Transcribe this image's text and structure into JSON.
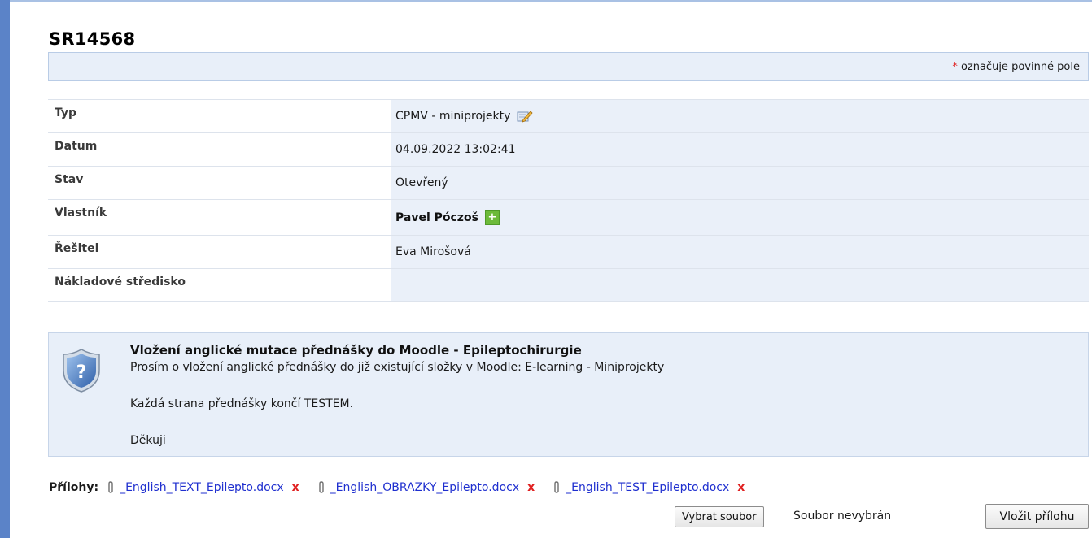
{
  "ticket": {
    "id": "SR14568"
  },
  "required_note": {
    "star": "*",
    "text": "označuje povinné pole"
  },
  "fields": [
    {
      "label": "Typ",
      "value": "CPMV - miniprojekty"
    },
    {
      "label": "Datum",
      "value": "04.09.2022 13:02:41"
    },
    {
      "label": "Stav",
      "value": "Otevřený"
    },
    {
      "label": "Vlastník",
      "value": "Pavel Póczoš"
    },
    {
      "label": "Řešitel",
      "value": "Eva Mirošová"
    },
    {
      "label": "Nákladové středisko",
      "value": ""
    }
  ],
  "description": {
    "title": "Vložení anglické mutace přednášky do Moodle - Epileptochirurgie",
    "lines": [
      "Prosím o vložení anglické přednášky do již existující složky v Moodle: E-learning - Miniprojekty",
      "Každá strana přednášky končí TESTEM.",
      "Děkuji"
    ]
  },
  "attachments": {
    "label": "Přílohy:",
    "files": [
      "_English_TEXT_Epilepto.docx",
      "_English_OBRAZKY_Epilepto.docx",
      "_English_TEST_Epilepto.docx"
    ],
    "delete_symbol": "x"
  },
  "upload": {
    "choose_label": "Vybrat soubor",
    "no_file_text": "Soubor nevybrán",
    "insert_label": "Vložit přílohu"
  },
  "icons": {
    "edit": "edit-icon",
    "add": "add-icon",
    "shield": "shield-question-icon",
    "attachment": "paperclip-icon"
  },
  "colors": {
    "accent": "#5b83c8",
    "panel": "#e8eff9",
    "link": "#1f2fcf",
    "delete": "#e02020",
    "add": "#6cba3a"
  }
}
